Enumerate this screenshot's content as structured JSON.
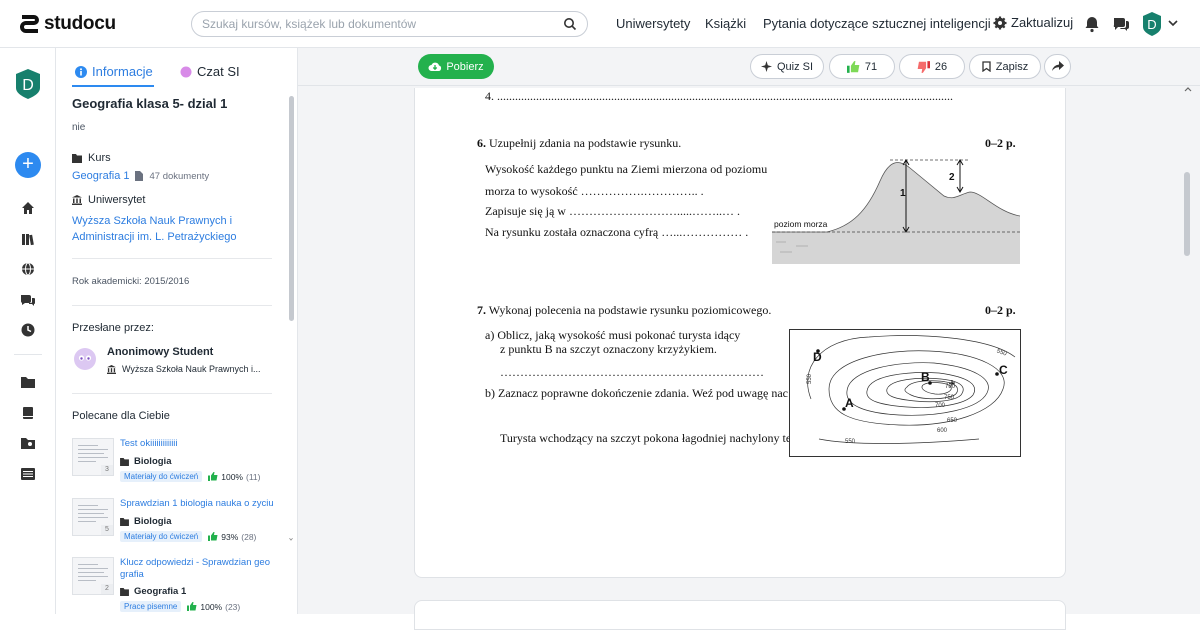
{
  "header": {
    "logo_text": "studocu",
    "search_placeholder": "Szukaj kursów, książek lub dokumentów",
    "nav": [
      "Uniwersytety",
      "Książki",
      "Pytania dotyczące sztucznej inteligencji"
    ],
    "update_label": "Zaktualizuj",
    "avatar_letter": "D"
  },
  "rail": {
    "avatar_letter": "D"
  },
  "sidebar": {
    "tabs": [
      {
        "label": "Informacje"
      },
      {
        "label": "Czat SI"
      }
    ],
    "doc_title": "Geografia klasa 5- dzial 1",
    "doc_desc": "nie",
    "course_label": "Kurs",
    "course_link": "Geografia 1",
    "course_docs": "47 dokumenty",
    "university_label": "Uniwersytet",
    "university_line1": "Wyższa Szkoła Nauk Prawnych i",
    "university_line2": "Administracji im. L. Petrażyckiego",
    "academic_year": "Rok akademicki: 2015/2016",
    "uploaded_by_label": "Przesłane przez:",
    "uploader_name": "Anonimowy Student",
    "uploader_uni": "Wyższa Szkoła Nauk Prawnych i...",
    "recommended_label": "Polecane dla Ciebie",
    "recommended": [
      {
        "title": "Test okiiiiiiiiiiiii",
        "category": "Biologia",
        "badge": "Materiały do ćwiczeń",
        "rating": "100%",
        "count": "(11)",
        "pages": "3"
      },
      {
        "title": "Sprawdzian 1 biologia nauka o zyciu",
        "category": "Biologia",
        "badge": "Materiały do ćwiczeń",
        "rating": "93%",
        "count": "(28)",
        "pages": "5"
      },
      {
        "title": "Klucz odpowiedzi - Sprawdzian geo grafia",
        "category": "Geografia 1",
        "badge": "Prace pisemne",
        "rating": "100%",
        "count": "(23)",
        "pages": "2"
      }
    ]
  },
  "toolbar": {
    "download": "Pobierz",
    "quiz": "Quiz SI",
    "likes": "71",
    "dislikes": "26",
    "save": "Zapisz"
  },
  "page": {
    "line_4": "4. ........................................................................................................................................................",
    "q6_num": "6.",
    "q6_text": "Uzupełnij zdania na podstawie rysunku.",
    "q6_points": "0–2 p.",
    "q6_line1": "Wysokość każdego punktu na Ziemi mierzona od poziomu",
    "q6_line2": "morza to wysokość …………….………….. .",
    "q6_line3": "Zapisuje się ją w ……………………….....……..… .",
    "q6_line4": "Na rysunku została oznaczona cyfrą …...…………… .",
    "q6_fig_sea": "poziom morza",
    "q6_fig_1": "1",
    "q6_fig_2": "2",
    "q7_num": "7.",
    "q7_text": "Wykonaj polecenia na podstawie rysunku poziomicowego.",
    "q7_points": "0–2 p.",
    "q7_a1": "a)  Oblicz, jaką wysokość musi pokonać turysta idący",
    "q7_a2": "z punktu B na szczyt oznaczony krzyżykiem.",
    "q7_a3": "…………………………………………………………",
    "q7_b1": "b)  Zaznacz poprawne dokończenie zdania. Weź pod uwagę nac",
    "q7_b2": "Turysta wchodzący na szczyt pokona łagodniej nachylony te",
    "map": {
      "labels": {
        "D": "D",
        "B": "B",
        "C": "C",
        "A": "A"
      },
      "contours": {
        "c550a": "550",
        "c550b": "550",
        "c550c": "550",
        "c600": "600",
        "c650": "650",
        "c700": "700",
        "c750": "750",
        "c780": "780"
      }
    }
  },
  "colors": {
    "accent": "#2d8af0",
    "download_green": "#23b14d",
    "link": "#2d7de0"
  }
}
